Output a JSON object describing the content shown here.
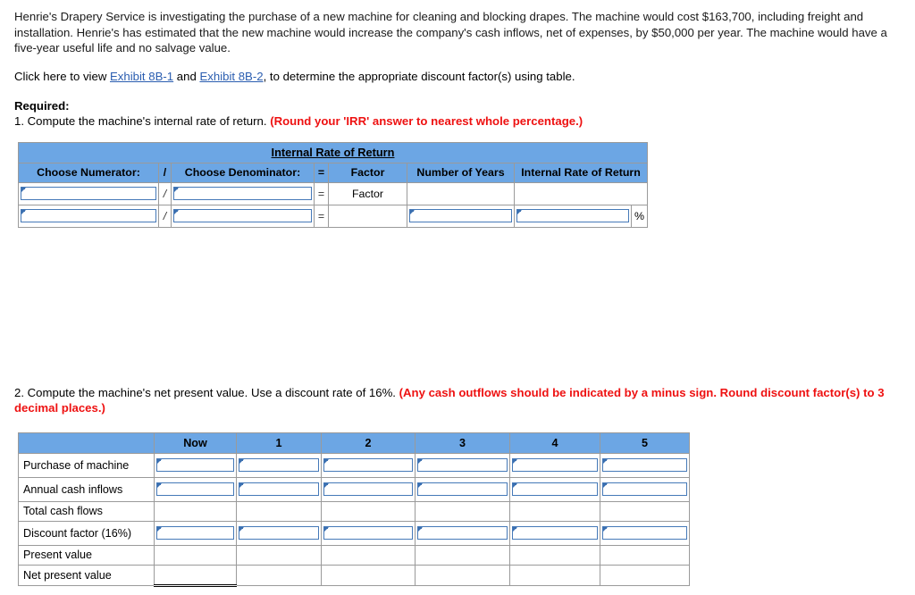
{
  "problem": {
    "paragraph": "Henrie's Drapery Service is investigating the purchase of a new machine for cleaning and blocking drapes. The machine would cost $163,700, including freight and installation. Henrie's has estimated that the new machine would increase the company's cash inflows, net of expenses, by $50,000 per year. The machine would have a five-year useful life and no salvage value.",
    "click_prefix": "Click here to view ",
    "link_1": "Exhibit 8B-1",
    "link_conjunction": " and ",
    "link_2": "Exhibit 8B-2",
    "click_suffix": ", to determine the appropriate discount factor(s) using table.",
    "required_label": "Required:",
    "q1_text": "1. Compute the machine's internal rate of return. ",
    "q1_note": "(Round your 'IRR' answer to nearest whole percentage.)",
    "q2_text": "2. Compute the machine's net present value. Use a discount rate of 16%. ",
    "q2_note": "(Any cash outflows should be indicated by a minus sign. Round discount factor(s) to 3 decimal places.)"
  },
  "irr_table": {
    "title": "Internal Rate of Return",
    "headers": {
      "numerator": "Choose Numerator:",
      "slash": "/",
      "denominator": "Choose Denominator:",
      "equals": "=",
      "factor": "Factor",
      "years": "Number of Years",
      "irr": "Internal Rate of Return"
    },
    "row1": {
      "numerator": "",
      "slash": "/",
      "denominator": "",
      "equals": "=",
      "factor": "Factor",
      "years": "",
      "irr": ""
    },
    "row2": {
      "numerator": "",
      "slash": "/",
      "denominator": "",
      "equals": "=",
      "factor": "",
      "years": "",
      "irr": "",
      "percent_symbol": "%"
    }
  },
  "npv_table": {
    "headers": [
      "",
      "Now",
      "1",
      "2",
      "3",
      "4",
      "5"
    ],
    "rows": [
      {
        "label": "Purchase of machine",
        "type": "input",
        "values": [
          "",
          "",
          "",
          "",
          "",
          ""
        ]
      },
      {
        "label": "Annual cash inflows",
        "type": "input",
        "values": [
          "",
          "",
          "",
          "",
          "",
          ""
        ]
      },
      {
        "label": "Total cash flows",
        "type": "plain",
        "values": [
          "",
          "",
          "",
          "",
          "",
          ""
        ]
      },
      {
        "label": "Discount factor (16%)",
        "type": "input",
        "values": [
          "",
          "",
          "",
          "",
          "",
          ""
        ]
      },
      {
        "label": "Present value",
        "type": "plain",
        "values": [
          "",
          "",
          "",
          "",
          "",
          ""
        ]
      },
      {
        "label": "Net present value",
        "type": "total",
        "values": [
          "",
          "",
          "",
          "",
          "",
          ""
        ]
      }
    ]
  },
  "colors": {
    "header_blue": "#6ca6e4",
    "input_border": "#4579b8",
    "link_blue": "#2a5db0",
    "note_red": "#ee1111"
  }
}
